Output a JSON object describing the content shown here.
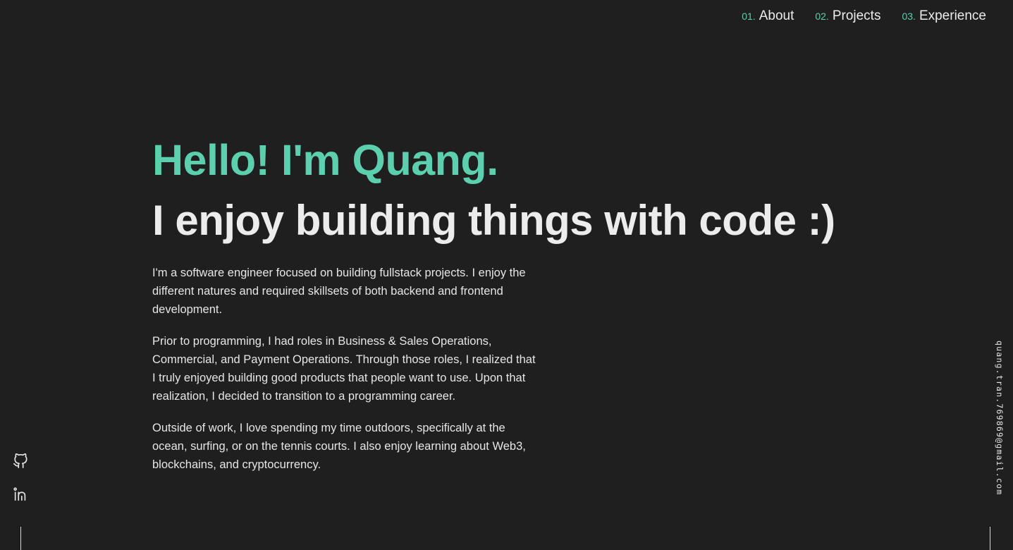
{
  "nav": {
    "items": [
      {
        "num": "01.",
        "label": "About"
      },
      {
        "num": "02.",
        "label": "Projects"
      },
      {
        "num": "03.",
        "label": "Experience"
      }
    ]
  },
  "hero": {
    "greeting": "Hello! I'm Quang.",
    "tagline": "I enjoy building things with code :)",
    "paragraphs": [
      "I'm a software engineer focused on building fullstack projects. I enjoy the different natures and required skillsets of both backend and frontend development.",
      "Prior to programming, I had roles in Business & Sales Operations, Commercial, and Payment Operations. Through those roles, I realized that I truly enjoyed building good products that people want to use. Upon that realization, I decided to transition to a programming career.",
      "Outside of work, I love spending my time outdoors, specifically at the ocean, surfing, or on the tennis courts. I also enjoy learning about Web3, blockchains, and cryptocurrency."
    ]
  },
  "socials": {
    "icons": [
      "github-icon",
      "linkedin-icon"
    ]
  },
  "contact": {
    "email": "quang.tran.769869@gmail.com"
  },
  "colors": {
    "background": "#1f1f1f",
    "accent": "#5ccfae",
    "text": "#ececec"
  }
}
